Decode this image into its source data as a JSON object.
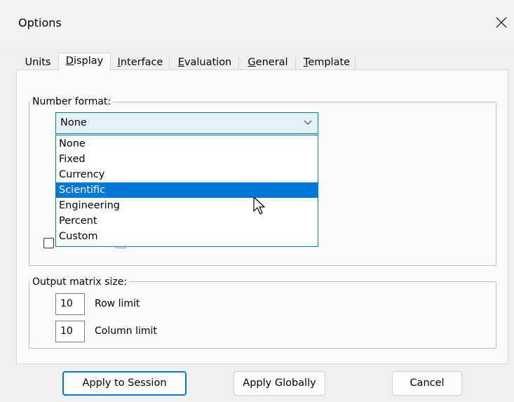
{
  "window": {
    "title": "Options"
  },
  "tabs": [
    {
      "label": "Units",
      "accel": "",
      "rest": "Units"
    },
    {
      "label": "Display",
      "accel": "D",
      "rest": "isplay"
    },
    {
      "label": "Interface",
      "accel": "I",
      "rest": "nterface"
    },
    {
      "label": "Evaluation",
      "accel": "E",
      "rest": "valuation"
    },
    {
      "label": "General",
      "accel": "G",
      "rest": "eneral"
    },
    {
      "label": "Template",
      "accel": "T",
      "rest": "emplate"
    }
  ],
  "active_tab": "Display",
  "number_format": {
    "label": "Number format:",
    "selected_value": "None",
    "options": [
      "None",
      "Fixed",
      "Currency",
      "Scientific",
      "Engineering",
      "Percent",
      "Custom"
    ],
    "highlighted": "Scientific"
  },
  "output_matrix": {
    "label": "Output matrix size:",
    "row_limit": {
      "value": "10",
      "label": "Row limit"
    },
    "column_limit": {
      "value": "10",
      "label": "Column limit"
    }
  },
  "buttons": {
    "apply_session": "Apply to Session",
    "apply_globally": "Apply Globally",
    "cancel": "Cancel"
  },
  "colors": {
    "accent": "#0078d7",
    "selection_text": "#ffffff",
    "combo_bg": "#e5f1fb"
  },
  "icons": {
    "close": "close-icon",
    "dropdown": "chevron-down-icon",
    "cursor": "mouse-pointer-icon"
  }
}
